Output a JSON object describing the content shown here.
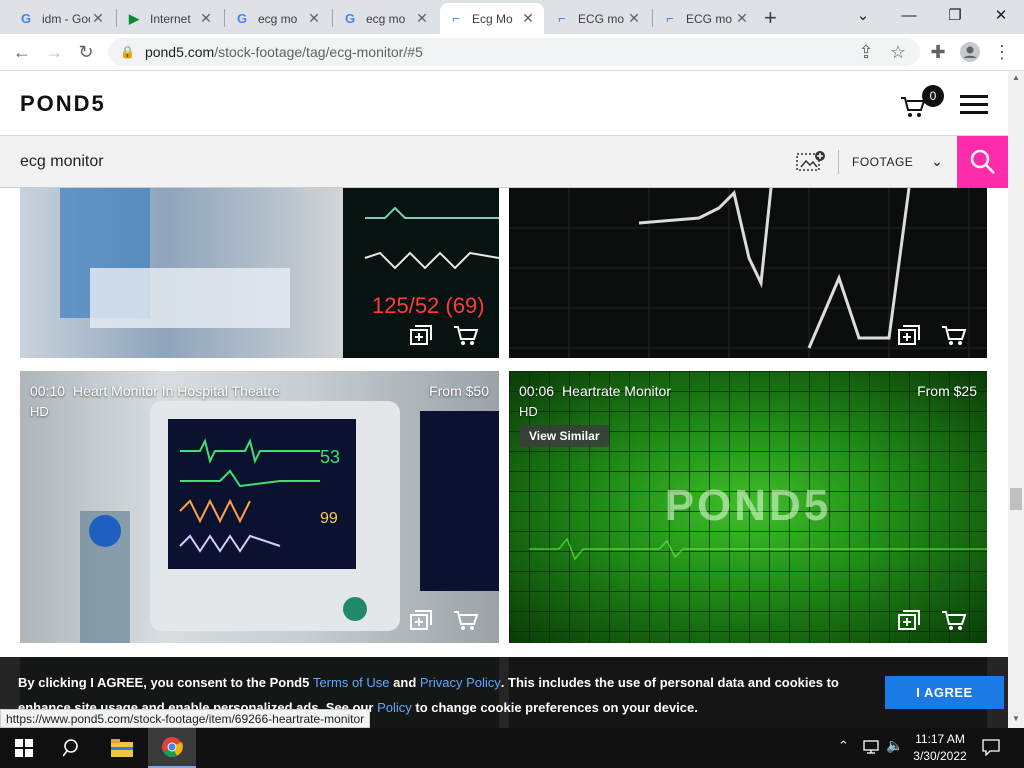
{
  "browser": {
    "tabs": [
      {
        "title": "idm - Goo",
        "icon": "google-icon",
        "active": false
      },
      {
        "title": "Internet",
        "icon": "play-icon",
        "active": false
      },
      {
        "title": "ecg mo",
        "icon": "google-icon",
        "active": false
      },
      {
        "title": "ecg mo",
        "icon": "google-icon",
        "active": false
      },
      {
        "title": "Ecg Mo",
        "icon": "pond5-icon",
        "active": true
      },
      {
        "title": "ECG mo",
        "icon": "pond5-icon",
        "active": false
      },
      {
        "title": "ECG mo",
        "icon": "pond5-icon",
        "active": false
      }
    ],
    "new_tab": "+",
    "url_host": "pond5.com",
    "url_path": "/stock-footage/tag/ecg-monitor/#5"
  },
  "header": {
    "logo": "POND5",
    "cart_count": "0"
  },
  "search": {
    "query": "ecg monitor",
    "category": "FOOTAGE"
  },
  "clips": [
    {
      "duration": "",
      "title": "",
      "price": "",
      "resolution": ""
    },
    {
      "duration": "",
      "title": "",
      "price": "",
      "resolution": ""
    },
    {
      "duration": "00:10",
      "title": "Heart Monitor In Hospital Theatre",
      "price": "From $50",
      "resolution": "HD"
    },
    {
      "duration": "00:06",
      "title": "Heartrate Monitor",
      "price": "From $25",
      "resolution": "HD",
      "view_similar": "View Similar",
      "watermark": "POND5"
    }
  ],
  "cookie_banner": {
    "text_1": "By clicking I AGREE, you consent to the Pond5 ",
    "terms_link": "Terms of Use",
    "and": " and ",
    "privacy_link": "Privacy Policy",
    "text_2": ". This includes the use of personal data and cookies to enhance site usage and enable personalized ads. See our ",
    "policy_link": "Policy",
    "text_3": " to change cookie preferences on your device.",
    "agree_label": "I AGREE"
  },
  "status_bar_url": "https://www.pond5.com/stock-footage/item/69266-heartrate-monitor",
  "taskbar": {
    "time": "11:17 AM",
    "date": "3/30/2022"
  },
  "colors": {
    "accent_pink": "#ff2bad",
    "agree_blue": "#1a7ae6"
  }
}
